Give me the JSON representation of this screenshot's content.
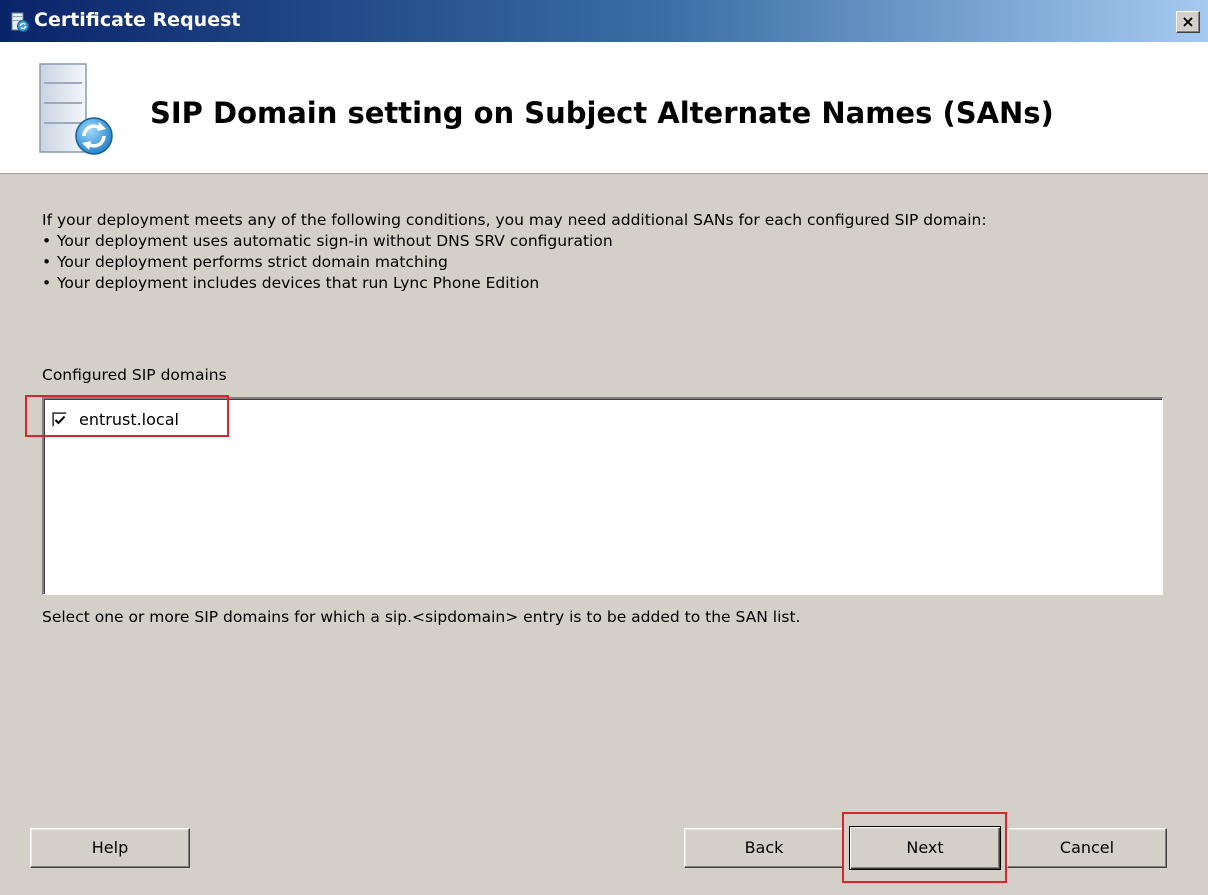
{
  "window": {
    "title": "Certificate Request",
    "close_label": "×"
  },
  "header": {
    "heading": "SIP Domain setting on Subject Alternate Names (SANs)"
  },
  "intro": {
    "paragraph": "If your deployment meets any of the following conditions, you may need additional SANs for each configured SIP domain:",
    "bullets": [
      "Your deployment uses automatic sign-in without DNS SRV configuration",
      "Your deployment performs strict domain matching",
      "Your deployment includes devices that run Lync Phone Edition"
    ],
    "bullet_glyph": "•"
  },
  "domains": {
    "label": "Configured SIP domains",
    "items": [
      {
        "name": "entrust.local",
        "checked": true
      }
    ],
    "hint": "Select one or more SIP domains for which a sip.<sipdomain> entry is to be added to the SAN list."
  },
  "buttons": {
    "help": "Help",
    "back": "Back",
    "next": "Next",
    "cancel": "Cancel"
  },
  "colors": {
    "titlebar_start": "#0a246a",
    "titlebar_end": "#a6caf0",
    "highlight": "#d9262e",
    "dialog_bg": "#d4d0c8"
  },
  "icons": {
    "app": "certificate-request-icon",
    "header": "server-refresh-icon",
    "close": "close-icon",
    "check": "checkmark-icon"
  }
}
